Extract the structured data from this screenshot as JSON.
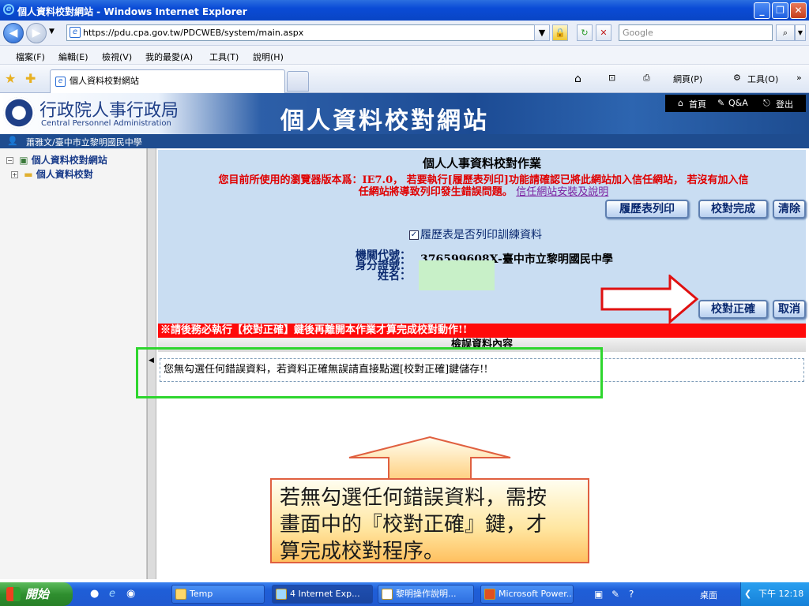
{
  "window": {
    "title": "個人資料校對網站 - Windows Internet Explorer",
    "min": "_",
    "max": "❐",
    "close": "✕"
  },
  "address": {
    "url": "https://pdu.cpa.gov.tw/PDCWEB/system/main.aspx",
    "search_placeholder": "Google"
  },
  "menu": [
    "檔案(F)",
    "編輯(E)",
    "檢視(V)",
    "我的最愛(A)",
    "工具(T)",
    "說明(H)"
  ],
  "tabs": {
    "active": "個人資料校對網站",
    "toolbar_home": "",
    "toolbar_page": "網頁(P)",
    "toolbar_tools": "工具(O)"
  },
  "header": {
    "org_cn": "行政院人事行政局",
    "org_en": "Central Personnel Administration",
    "site_title": "個人資料校對網站",
    "links": [
      "首頁",
      "Q&A",
      "登出"
    ]
  },
  "user": {
    "name": "蕭雅文/臺中市立黎明國民中學"
  },
  "tree": {
    "root": "個人資料校對網站",
    "child": "個人資料校對"
  },
  "main": {
    "heading": "個人人事資料校對作業",
    "warning_line1": "您目前所使用的瀏覽器版本爲：IE7.0， 若要執行[履歷表列印]功能請確認已將此網站加入信任網站， 若沒有加入信",
    "warning_line2": "任網站將導致列印發生錯誤問題。",
    "warning_link": "信任網站安裝及說明",
    "btn_print": "履歷表列印",
    "btn_done": "校對完成",
    "btn_clear": "清除",
    "checkbox_label": "履歷表是否列印訓練資料",
    "checkbox_mark": "✓",
    "label_org": "機關代號：",
    "label_id": "身分證號：",
    "label_name": "姓名：",
    "org_value": "376599608X-臺中市立黎明國民中學",
    "btn_correct": "校對正確",
    "btn_cancel": "取消",
    "red_notice": "※請後務必執行【校對正確】鍵後再離開本作業才算完成校對動作!!",
    "error_heading": "檢誤資料內容",
    "error_message": "您無勾選任何錯誤資料，若資料正確無誤請直接點選[校對正確]鍵儲存!!"
  },
  "callout": {
    "text_line1": "若無勾選任何錯誤資料，需按",
    "text_line2": "畫面中的『校對正確』鍵，才",
    "text_line3": "算完成校對程序。"
  },
  "taskbar": {
    "start": "開始",
    "items": [
      "Temp",
      "4 Internet Exp...",
      "黎明操作說明...",
      "Microsoft Power..."
    ],
    "desktop": "桌面",
    "clock": "下午 12:18"
  },
  "colors": {
    "warning_red": "#e00000",
    "callout_border": "#e06040",
    "highlight_green": "#2ed62e"
  }
}
